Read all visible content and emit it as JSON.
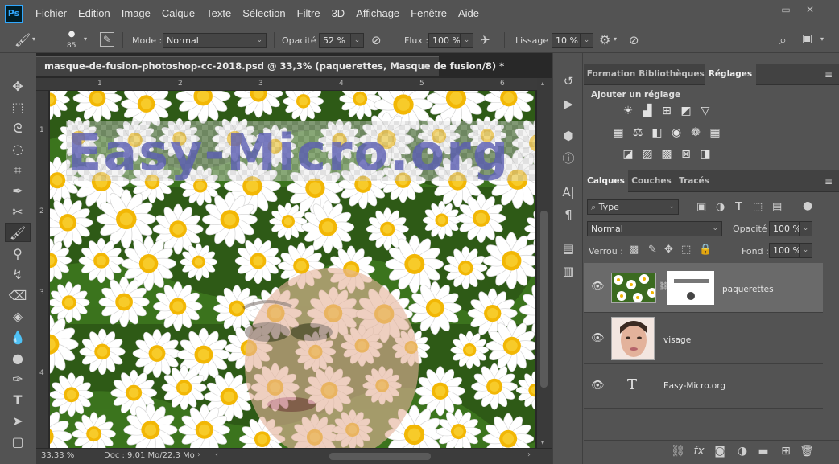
{
  "menu": [
    "Fichier",
    "Edition",
    "Image",
    "Calque",
    "Texte",
    "Sélection",
    "Filtre",
    "3D",
    "Affichage",
    "Fenêtre",
    "Aide"
  ],
  "options": {
    "brush_size": "85",
    "mode_label": "Mode :",
    "mode_value": "Normal",
    "opacity_label": "Opacité :",
    "opacity_value": "52 %",
    "flow_label": "Flux :",
    "flow_value": "100 %",
    "smoothing_label": "Lissage :",
    "smoothing_value": "10 %"
  },
  "document": {
    "tab_title": "masque-de-fusion-photoshop-cc-2018.psd @ 33,3% (paquerettes, Masque de fusion/8) *",
    "close": "×",
    "watermark": "Easy-Micro.org",
    "ruler_top": [
      "1",
      "2",
      "3",
      "4",
      "5",
      "6"
    ],
    "ruler_left": [
      "1",
      "2",
      "3",
      "4"
    ],
    "zoom": "33,33 %",
    "doc_info": "Doc : 9,01 Mo/22,3 Mo"
  },
  "panels": {
    "top_tabs": [
      "Formation",
      "Bibliothèques",
      "Réglages"
    ],
    "adjust_title": "Ajouter un réglage",
    "layer_tabs": [
      "Calques",
      "Couches",
      "Tracés"
    ],
    "filter_type": "Type",
    "blend_mode": "Normal",
    "opacity_label": "Opacité :",
    "opacity_value": "100 %",
    "lock_label": "Verrou :",
    "fill_label": "Fond :",
    "fill_value": "100 %",
    "layers": [
      {
        "name": "paquerettes"
      },
      {
        "name": "visage"
      },
      {
        "name": "Easy-Micro.org"
      }
    ]
  },
  "colors": {
    "accent": "#31a8ff",
    "panel": "#535353",
    "dark": "#282828"
  }
}
